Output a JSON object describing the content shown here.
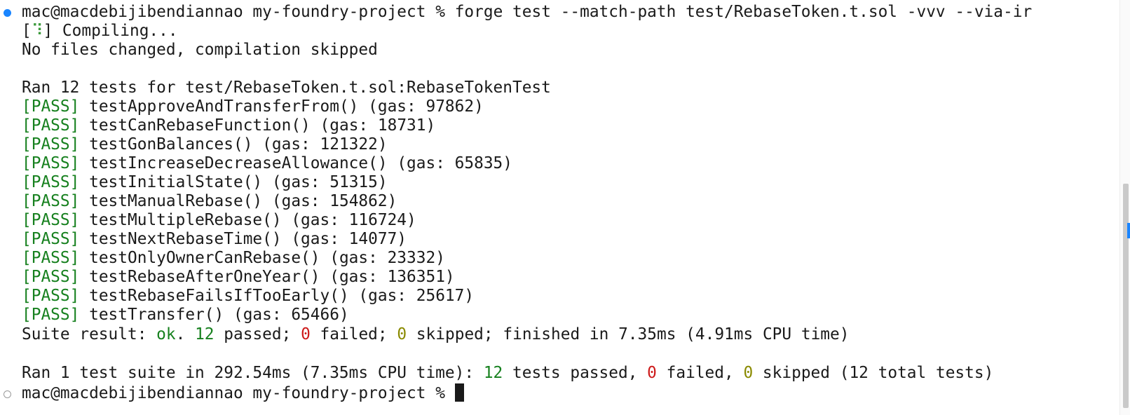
{
  "colors": {
    "pass": "#16801e",
    "fail": "#cd1a1a",
    "skip": "#8a8a00",
    "marker_active": "#1a85ff",
    "text": "#1a1a1a"
  },
  "prompt": {
    "user_host": "mac@macdebijibendiannao",
    "directory": "my-foundry-project",
    "symbol": "%",
    "command": "forge test --match-path test/RebaseToken.t.sol -vvv --via-ir"
  },
  "compile": {
    "spinner": "⠹",
    "status": "Compiling...",
    "result": "No files changed, compilation skipped"
  },
  "suite_header": "Ran 12 tests for test/RebaseToken.t.sol:RebaseTokenTest",
  "tests": [
    {
      "status": "[PASS]",
      "name": "testApproveAndTransferFrom()",
      "gas": "(gas: 97862)"
    },
    {
      "status": "[PASS]",
      "name": "testCanRebaseFunction()",
      "gas": "(gas: 18731)"
    },
    {
      "status": "[PASS]",
      "name": "testGonBalances()",
      "gas": "(gas: 121322)"
    },
    {
      "status": "[PASS]",
      "name": "testIncreaseDecreaseAllowance()",
      "gas": "(gas: 65835)"
    },
    {
      "status": "[PASS]",
      "name": "testInitialState()",
      "gas": "(gas: 51315)"
    },
    {
      "status": "[PASS]",
      "name": "testManualRebase()",
      "gas": "(gas: 154862)"
    },
    {
      "status": "[PASS]",
      "name": "testMultipleRebase()",
      "gas": "(gas: 116724)"
    },
    {
      "status": "[PASS]",
      "name": "testNextRebaseTime()",
      "gas": "(gas: 14077)"
    },
    {
      "status": "[PASS]",
      "name": "testOnlyOwnerCanRebase()",
      "gas": "(gas: 23332)"
    },
    {
      "status": "[PASS]",
      "name": "testRebaseAfterOneYear()",
      "gas": "(gas: 136351)"
    },
    {
      "status": "[PASS]",
      "name": "testRebaseFailsIfTooEarly()",
      "gas": "(gas: 25617)"
    },
    {
      "status": "[PASS]",
      "name": "testTransfer()",
      "gas": "(gas: 65466)"
    }
  ],
  "suite_result": {
    "prefix": "Suite result:",
    "ok": "ok",
    "passed_count": "12",
    "passed_label": "passed;",
    "failed_count": "0",
    "failed_label": "failed;",
    "skipped_count": "0",
    "skipped_label": "skipped;",
    "timing": "finished in 7.35ms (4.91ms CPU time)"
  },
  "summary": {
    "prefix": "Ran 1 test suite in 292.54ms (7.35ms CPU time):",
    "passed_count": "12",
    "passed_label": "tests passed,",
    "failed_count": "0",
    "failed_label": "failed,",
    "skipped_count": "0",
    "skipped_label": "skipped (12 total tests)"
  }
}
